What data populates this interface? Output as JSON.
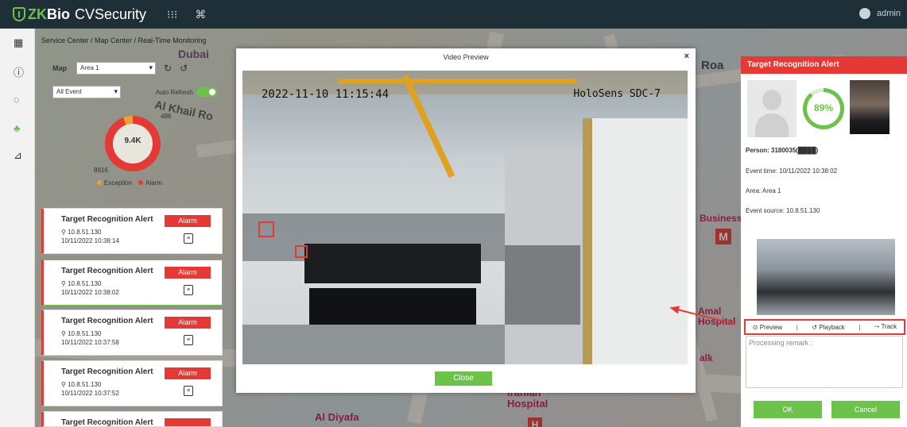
{
  "app": {
    "logo_prefix": "ZK",
    "logo_bio": "Bio",
    "logo_rest": "CVSecurity",
    "user": "admin"
  },
  "breadcrumb": "Service Center / Map Center / Real-Time Monitoring",
  "map_labels": [
    "Dubai",
    "Al Khail Ro",
    "Al Diyafa",
    "Iranian Hospital",
    "Business",
    "Amal Hospital",
    "Roa",
    "alk"
  ],
  "controls": {
    "map_label": "Map",
    "area_value": "Area 1",
    "event_filter": "All Event",
    "auto_refresh": "Auto Refresh"
  },
  "chart_data": {
    "type": "pie",
    "total_label": "9.4K",
    "categories": [
      "Exception",
      "Alarm"
    ],
    "values": [
      486,
      8916
    ],
    "colors": [
      "#f0a030",
      "#e53935"
    ]
  },
  "events": [
    {
      "title": "Target Recognition Alert",
      "badge": "Alarm",
      "ip": "10.8.51.130",
      "time": "10/11/2022 10:38:14"
    },
    {
      "title": "Target Recognition Alert",
      "badge": "Alarm",
      "ip": "10.8.51.130",
      "time": "10/11/2022 10:38:02"
    },
    {
      "title": "Target Recognition Alert",
      "badge": "Alarm",
      "ip": "10.8.51.130",
      "time": "10/11/2022 10:37:58"
    },
    {
      "title": "Target Recognition Alert",
      "badge": "Alarm",
      "ip": "10.8.51.130",
      "time": "10/11/2022 10:37:52"
    },
    {
      "title": "Target Recognition Alert",
      "badge": "Alarm",
      "ip": "",
      "time": ""
    }
  ],
  "video": {
    "title": "Video Preview",
    "close_x": "×",
    "timestamp": "2022-11-10 11:15:44",
    "camera": "HoloSens SDC-7",
    "close_label": "Close"
  },
  "alert": {
    "title": "Target Recognition Alert",
    "score": "89%",
    "person": "Person: 3180035(████)",
    "event_time": "Event time: 10/11/2022 10:38:02",
    "area": "Area: Area 1",
    "event_source": "Event source: 10.8.51.130",
    "preview": "Preview",
    "playback": "Playback",
    "track": "Track",
    "remark_placeholder": "Processing remark :",
    "ok": "OK",
    "cancel": "Cancel"
  }
}
